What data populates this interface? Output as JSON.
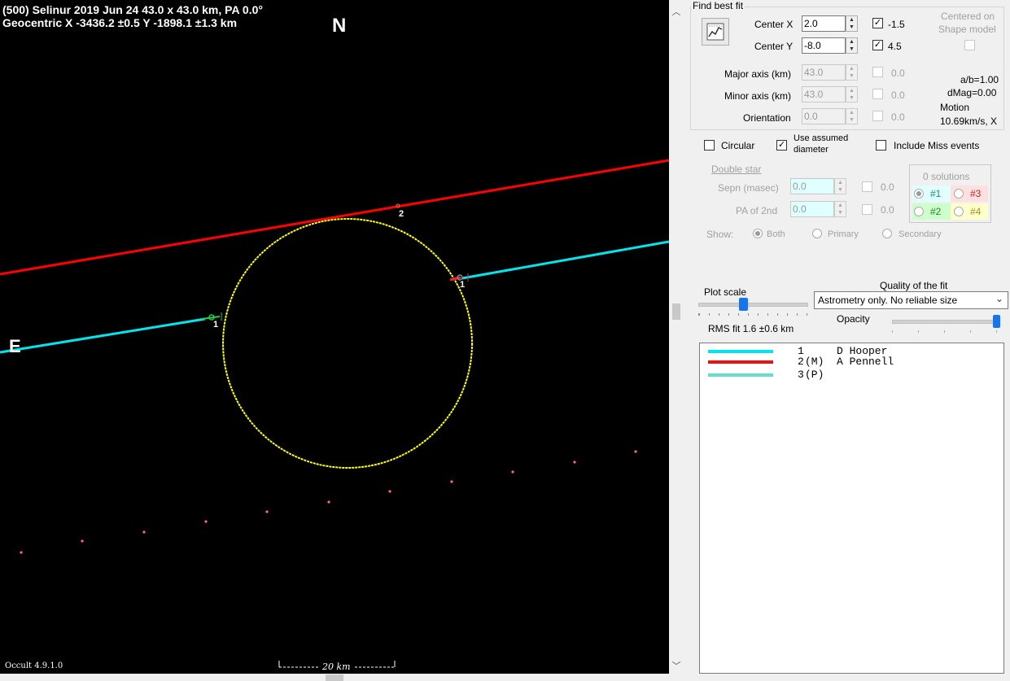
{
  "plot": {
    "header_line1": "(500) Selinur  2019 Jun 24  43.0 x 43.0 km, PA 0.0°",
    "header_line2": "Geocentric X  -3436.2 ±0.5  Y -1898.1 ±1.3 km",
    "north": "N",
    "east": "E",
    "version": "Occult 4.9.1.0",
    "scale_label": "20 km",
    "chord_labels": [
      "1",
      "2",
      "1"
    ],
    "colors": {
      "background": "#000000",
      "ellipse": "#ffff00",
      "chord_hooper": "#00e5ee",
      "chord_pennell": "#ff0000",
      "path_dots": "#ff6680"
    }
  },
  "panel": {
    "find_best_fit": "Find best fit",
    "fit_icon": "fit-chart-icon",
    "center_x_label": "Center X",
    "center_x_value": "2.0",
    "center_x_check_value": "-1.5",
    "center_y_label": "Center Y",
    "center_y_value": "-8.0",
    "center_y_check_value": "4.5",
    "centered_on": "Centered on",
    "shape_model": "Shape model",
    "major_axis_label": "Major axis (km)",
    "major_axis_value": "43.0",
    "major_axis_check_value": "0.0",
    "minor_axis_label": "Minor axis (km)",
    "minor_axis_value": "43.0",
    "minor_axis_check_value": "0.0",
    "orientation_label": "Orientation",
    "orientation_value": "0.0",
    "orientation_check_value": "0.0",
    "ab_ratio": "a/b=1.00",
    "dmag": "dMag=0.00",
    "motion_label": "Motion",
    "motion_value": "10.69km/s, X",
    "circular": "Circular",
    "use_assumed_1": "Use assumed",
    "use_assumed_2": "diameter",
    "include_miss": "Include Miss events",
    "double_star": "Double star",
    "sepn_label": "Sepn (masec)",
    "sepn_value": "0.0",
    "sepn_check_value": "0.0",
    "pa2_label": "PA of 2nd",
    "pa2_value": "0.0",
    "pa2_check_value": "0.0",
    "solutions": "0 solutions",
    "sol1": "#1",
    "sol2": "#2",
    "sol3": "#3",
    "sol4": "#4",
    "show_label": "Show:",
    "show_both": "Both",
    "show_primary": "Primary",
    "show_secondary": "Secondary",
    "plot_scale": "Plot scale",
    "quality_label": "Quality of the fit",
    "quality_value": "Astrometry only. No reliable size",
    "opacity": "Opacity",
    "rms_fit": "RMS fit 1.6 ±0.6 km",
    "observers": [
      {
        "num": "1",
        "mark": "   ",
        "name": "D Hooper",
        "color": "#00e5ee"
      },
      {
        "num": "2",
        "mark": "(M)",
        "name": "A Pennell",
        "color": "#ee1111"
      },
      {
        "num": "3",
        "mark": "(P)",
        "name": "",
        "color": "#66ddcc"
      }
    ]
  }
}
